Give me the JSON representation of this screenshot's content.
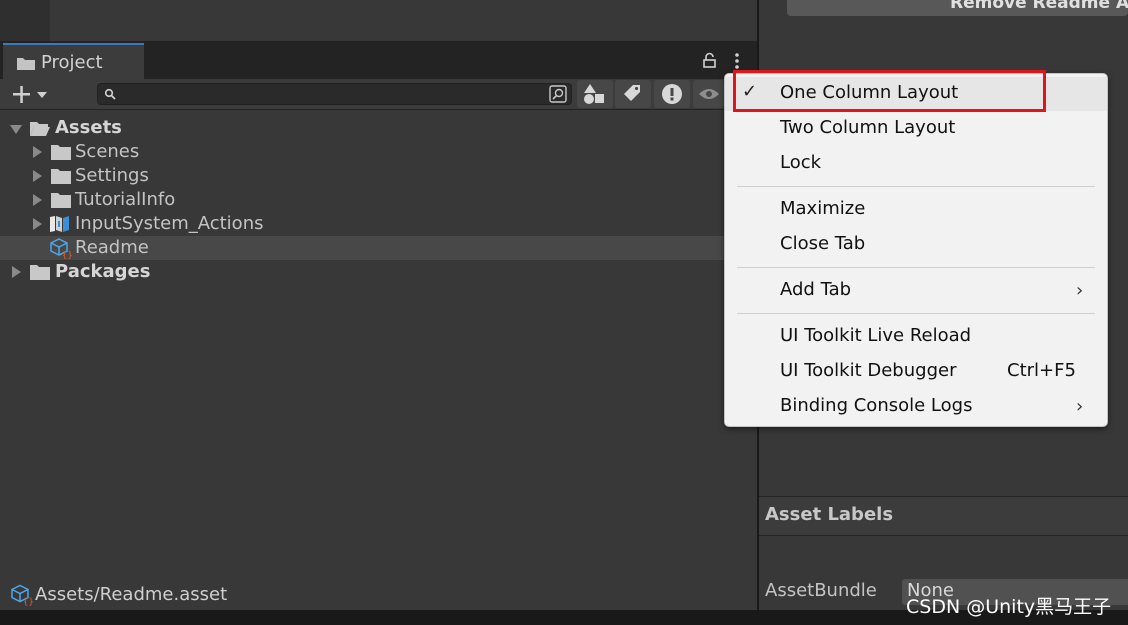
{
  "inspector": {
    "remove_button": "Remove Readme A",
    "asset_labels": "Asset Labels",
    "assetbundle_label": "AssetBundle",
    "assetbundle_value": "None"
  },
  "project": {
    "tab_label": "Project",
    "search_placeholder": "",
    "tree": [
      {
        "label": "Assets",
        "bold": true,
        "expanded": true,
        "icon": "folder-open-icon"
      },
      {
        "label": "Scenes",
        "icon": "folder-icon"
      },
      {
        "label": "Settings",
        "icon": "folder-icon"
      },
      {
        "label": "TutorialInfo",
        "icon": "folder-icon"
      },
      {
        "label": "InputSystem_Actions",
        "icon": "input-actions-icon"
      },
      {
        "label": "Readme",
        "icon": "scriptable-object-icon",
        "selected": true
      },
      {
        "label": "Packages",
        "bold": true,
        "icon": "folder-icon"
      }
    ],
    "status_path": "Assets/Readme.asset"
  },
  "context_menu": {
    "items": [
      {
        "label": "One Column Layout",
        "checked": true
      },
      {
        "label": "Two Column Layout"
      },
      {
        "label": "Lock"
      },
      {
        "label": "Maximize"
      },
      {
        "label": "Close Tab"
      },
      {
        "label": "Add Tab",
        "submenu": true
      },
      {
        "label": "UI Toolkit Live Reload"
      },
      {
        "label": "UI Toolkit Debugger",
        "shortcut": "Ctrl+F5"
      },
      {
        "label": "Binding Console Logs",
        "submenu": true
      }
    ],
    "check_glyph": "✓",
    "submenu_glyph": "›",
    "highlight_color": "#e0151b"
  },
  "watermark": "CSDN @Unity黑马王子"
}
